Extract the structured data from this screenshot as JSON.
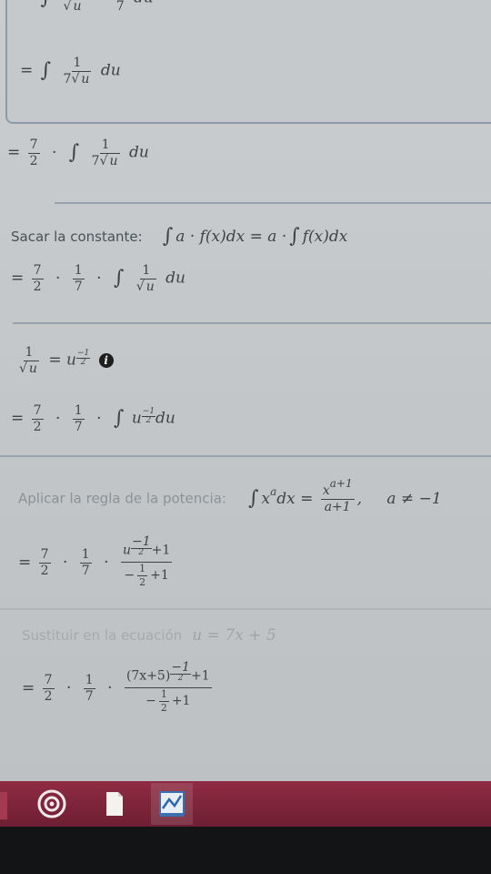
{
  "steps": {
    "s1": {
      "eq": "=",
      "num": "1",
      "den_var": "u",
      "dot": "·",
      "frac2_num": "1",
      "frac2_den": "7",
      "du": "du"
    },
    "s2": {
      "eq": "=",
      "num": "1",
      "den_coef": "7",
      "den_var": "u",
      "du": "du"
    },
    "s3": {
      "eq": "=",
      "f1_num": "7",
      "f1_den": "2",
      "dot": "·",
      "num": "1",
      "den_coef": "7",
      "den_var": "u",
      "du": "du"
    },
    "rule1": {
      "label": "Sacar la constante:",
      "formula_left": "a · f(x)dx = a ·",
      "formula_right": "f(x)dx"
    },
    "s4": {
      "eq": "=",
      "f1_num": "7",
      "f1_den": "2",
      "f2_num": "1",
      "f2_den": "7",
      "dot": "·",
      "num": "1",
      "den_var": "u",
      "du": "du"
    },
    "identity": {
      "num": "1",
      "den_var": "u",
      "rhs": "= u",
      "exp_sign": "−",
      "exp_num": "1",
      "exp_den": "2",
      "info_symbol": "i"
    },
    "s5": {
      "eq": "=",
      "f1_num": "7",
      "f1_den": "2",
      "f2_num": "1",
      "f2_den": "7",
      "dot": "·",
      "base": "u",
      "exp_sign": "−",
      "exp_num": "1",
      "exp_den": "2",
      "du": "du"
    },
    "rule2": {
      "label": "Aplicar la regla de la potencia:",
      "lhs_base": "x",
      "lhs_exp": "a",
      "dx": "dx",
      "eq": "=",
      "rhs_num_base": "x",
      "rhs_num_exp": "a+1",
      "rhs_den": "a+1",
      "comma": ",",
      "condition": "a ≠ −1"
    },
    "s6": {
      "eq": "=",
      "f1_num": "7",
      "f1_den": "2",
      "f2_num": "1",
      "f2_den": "7",
      "dot": "·",
      "num_base": "u",
      "exp_sign": "−",
      "exp_num": "1",
      "exp_den": "2",
      "exp_plus": "+1",
      "den_sign": "−",
      "den_num": "1",
      "den_den": "2",
      "den_plus": "+1"
    },
    "rule3": {
      "label": "Sustituir en la ecuación",
      "formula": "u = 7x + 5"
    },
    "s7": {
      "eq": "=",
      "f1_num": "7",
      "f1_den": "2",
      "f2_num": "1",
      "f2_den": "7",
      "dot": "·",
      "num_base": "(7x+5)",
      "exp_sign": "−",
      "exp_num": "1",
      "exp_den": "2",
      "exp_plus": "+1",
      "den_sign": "−",
      "den_num": "1",
      "den_den": "2",
      "den_plus": "+1"
    }
  },
  "taskbar": {
    "icons": [
      "start-ring-icon",
      "document-icon",
      "app-chart-icon"
    ],
    "colors": {
      "taskbar": "#7a2238",
      "bottom": "#121416"
    }
  }
}
